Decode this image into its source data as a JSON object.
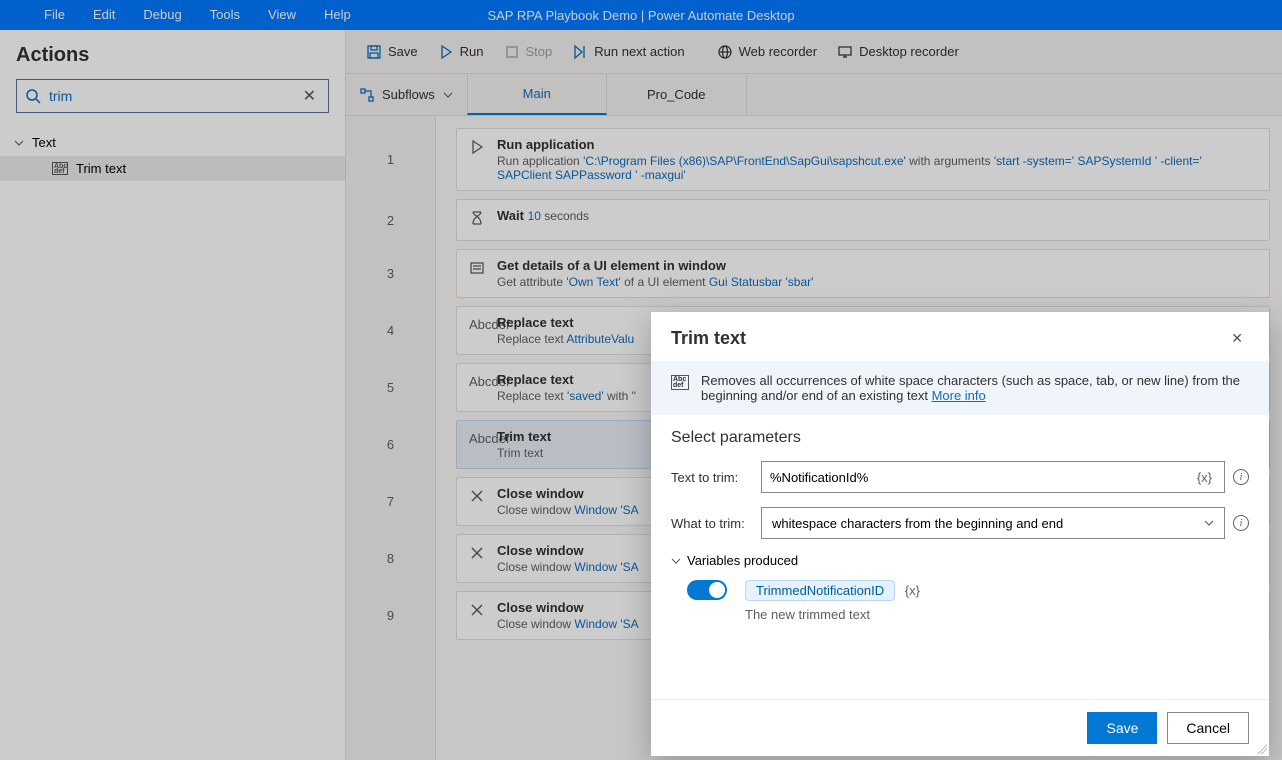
{
  "titlebar": {
    "menus": [
      "File",
      "Edit",
      "Debug",
      "Tools",
      "View",
      "Help"
    ],
    "title": "SAP RPA Playbook Demo | Power Automate Desktop"
  },
  "actions_panel": {
    "title": "Actions",
    "search_value": "trim",
    "group": "Text",
    "item": "Trim text"
  },
  "toolbar": {
    "save": "Save",
    "run": "Run",
    "stop": "Stop",
    "run_next": "Run next action",
    "web_rec": "Web recorder",
    "desk_rec": "Desktop recorder"
  },
  "subflows": {
    "label": "Subflows",
    "tabs": [
      "Main",
      "Pro_Code"
    ]
  },
  "steps": [
    {
      "n": "1",
      "title": "Run application",
      "desc_parts": [
        "Run application ",
        {
          "lk": "'C:\\Program Files (x86)\\SAP\\FrontEnd\\SapGui\\sapshcut.exe'"
        },
        " with arguments ",
        {
          "lk": "'start -system='"
        },
        "  ",
        {
          "lk": "SAPSystemId"
        },
        "  ",
        {
          "lk": "' -client='"
        },
        "  ",
        {
          "lk": "SAPClient"
        },
        "  ",
        {
          "lk": "SAPPassword"
        },
        "  ",
        {
          "lk": "' -maxgui'"
        }
      ],
      "icon": "play"
    },
    {
      "n": "2",
      "title": "Wait",
      "desc_parts": [
        {
          "lk": "10"
        },
        " seconds"
      ],
      "icon": "hourglass",
      "inline": true
    },
    {
      "n": "3",
      "title": "Get details of a UI element in window",
      "desc_parts": [
        "Get attribute ",
        {
          "lk": "'Own Text'"
        },
        " of a UI element ",
        {
          "lk": "Gui Statusbar 'sbar'"
        }
      ],
      "icon": "details"
    },
    {
      "n": "4",
      "title": "Replace text",
      "desc_parts": [
        "Replace text  ",
        {
          "lk": "AttributeValu"
        }
      ],
      "icon": "abc"
    },
    {
      "n": "5",
      "title": "Replace text",
      "desc_parts": [
        "Replace text ",
        {
          "lk": "'saved'"
        },
        " with \""
      ],
      "icon": "abc"
    },
    {
      "n": "6",
      "title": "Trim text",
      "desc_parts": [
        "Trim text"
      ],
      "icon": "abc",
      "selected": true
    },
    {
      "n": "7",
      "title": "Close window",
      "desc_parts": [
        "Close window ",
        {
          "lk": "Window 'SA"
        }
      ],
      "icon": "close"
    },
    {
      "n": "8",
      "title": "Close window",
      "desc_parts": [
        "Close window ",
        {
          "lk": "Window 'SA"
        }
      ],
      "icon": "close"
    },
    {
      "n": "9",
      "title": "Close window",
      "desc_parts": [
        "Close window ",
        {
          "lk": "Window 'SA"
        }
      ],
      "icon": "close"
    }
  ],
  "dialog": {
    "title": "Trim text",
    "info": "Removes all occurrences of white space characters (such as space, tab, or new line) from the beginning and/or end of an existing text ",
    "more": "More info",
    "section": "Select parameters",
    "label_text": "Text to trim:",
    "value_text": "%NotificationId%",
    "label_what": "What to trim:",
    "value_what": "whitespace characters from the beginning and end",
    "vars_header": "Variables produced",
    "var_name": "TrimmedNotificationID",
    "var_xi": "{x}",
    "var_desc": "The new trimmed text",
    "save": "Save",
    "cancel": "Cancel"
  }
}
